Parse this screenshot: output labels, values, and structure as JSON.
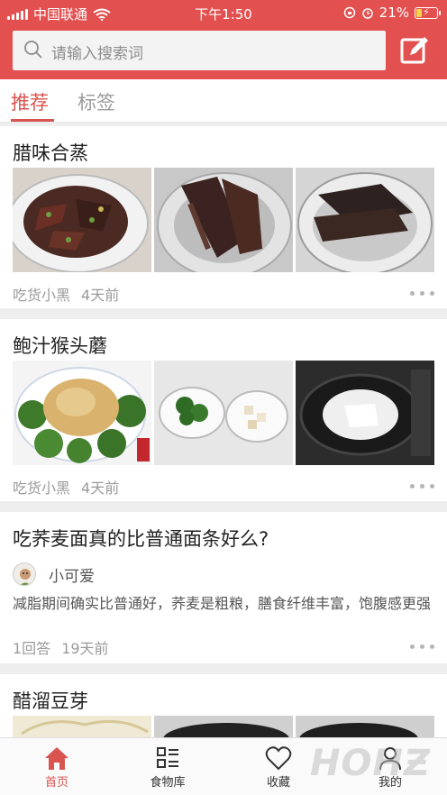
{
  "status_bar": {
    "carrier": "中国联通",
    "time": "下午1:50",
    "battery": "21%"
  },
  "search": {
    "placeholder": "请输入搜索词"
  },
  "tabs": [
    {
      "label": "推荐",
      "active": true
    },
    {
      "label": "标签",
      "active": false
    }
  ],
  "feed": [
    {
      "type": "recipe",
      "title": "腊味合蒸",
      "author": "吃货小黑",
      "time": "4天前"
    },
    {
      "type": "recipe",
      "title": "鲍汁猴头蘑",
      "author": "吃货小黑",
      "time": "4天前"
    },
    {
      "type": "question",
      "title": "吃荞麦面真的比普通面条好么?",
      "user": "小可爱",
      "excerpt": "减脂期间确实比普通好，荞麦是粗粮，膳食纤维丰富，饱腹感更强",
      "answers": "1回答",
      "time": "19天前"
    },
    {
      "type": "recipe",
      "title": "醋溜豆芽"
    }
  ],
  "bottom_nav": [
    {
      "label": "首页",
      "icon": "home-icon",
      "active": true
    },
    {
      "label": "食物库",
      "icon": "grid-list-icon",
      "active": false
    },
    {
      "label": "收藏",
      "icon": "heart-icon",
      "active": false
    },
    {
      "label": "我的",
      "icon": "person-icon",
      "active": false
    }
  ],
  "watermark": "ᕼOᕼƵ",
  "colors": {
    "brand": "#e35050",
    "active": "#d9534f",
    "muted": "#9a9a9a"
  }
}
